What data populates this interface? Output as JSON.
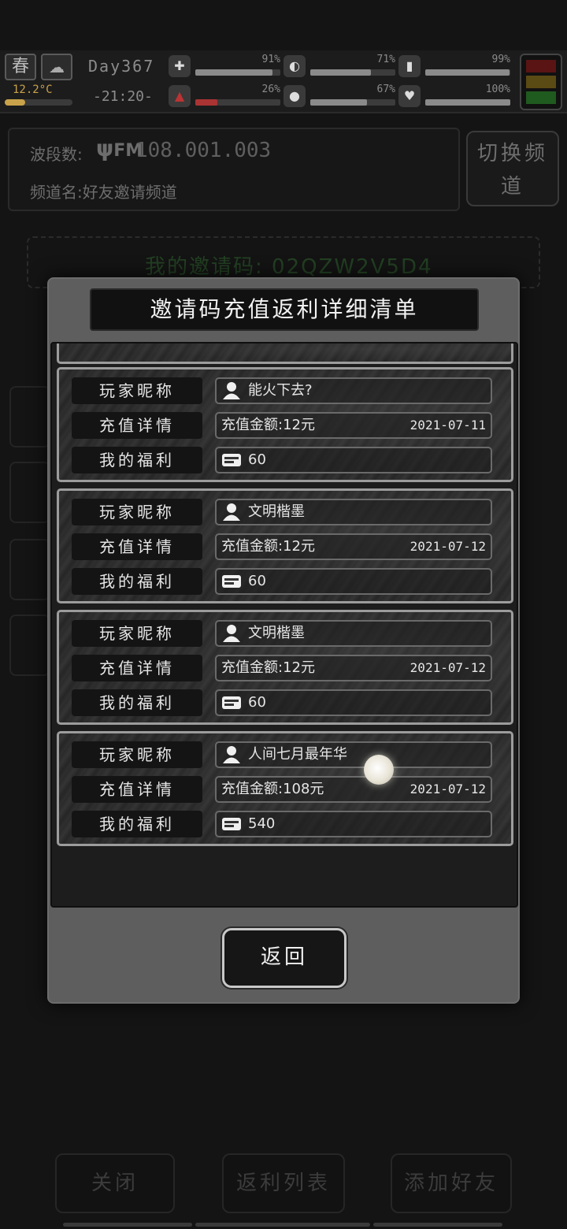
{
  "hud": {
    "season": "春",
    "temperature": "12.2°C",
    "day": "Day367",
    "time": "-21:20-",
    "stats": [
      {
        "name": "health-icon",
        "value": "91%",
        "fill": 0.91
      },
      {
        "name": "stomach-icon",
        "value": "71%",
        "fill": 0.71
      },
      {
        "name": "energy-icon",
        "value": "99%",
        "fill": 0.99
      },
      {
        "name": "boot-icon",
        "value": "26%",
        "fill": 0.26
      },
      {
        "name": "water-icon",
        "value": "67%",
        "fill": 0.67
      },
      {
        "name": "heart-icon",
        "value": "100%",
        "fill": 1.0
      }
    ],
    "signal_colors": [
      "#5a1414",
      "#5a4a14",
      "#1f5a1f"
    ]
  },
  "radio": {
    "band_label": "波段数:",
    "fm_label": "FM",
    "frequency": "108.001.003",
    "channel_label": "频道名:好友邀请频道",
    "switch_label": "切换频道"
  },
  "invite": {
    "code_text": "我的邀请码: 02QZW2V5D4"
  },
  "modal": {
    "title": "邀请码充值返利详细清单",
    "row_labels": {
      "player": "玩家昵称",
      "detail": "充值详情",
      "reward": "我的福利"
    },
    "entries": [
      {
        "player": "能火下去?",
        "detail": "充值金额:12元",
        "date": "2021-07-11",
        "reward": "60"
      },
      {
        "player": "文明楷墨",
        "detail": "充值金额:12元",
        "date": "2021-07-12",
        "reward": "60"
      },
      {
        "player": "文明楷墨",
        "detail": "充值金额:12元",
        "date": "2021-07-12",
        "reward": "60"
      },
      {
        "player": "人间七月最年华",
        "detail": "充值金额:108元",
        "date": "2021-07-12",
        "reward": "540"
      }
    ],
    "back_label": "返回"
  },
  "bottom": {
    "close_label": "关闭",
    "rebate_list_label": "返利列表",
    "add_friend_label": "添加好友"
  }
}
